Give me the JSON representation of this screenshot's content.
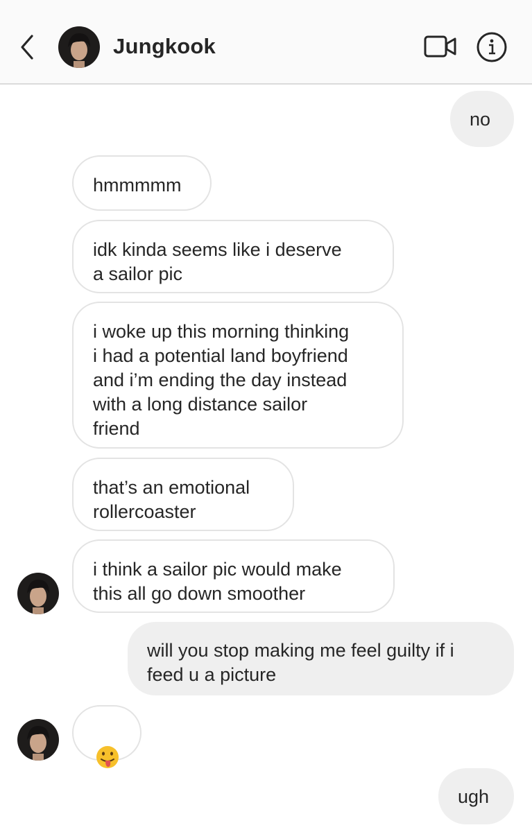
{
  "header": {
    "contact_name": "Jungkook",
    "back_icon": "chevron-left-icon",
    "video_icon": "video-camera-icon",
    "info_icon": "info-icon"
  },
  "messages": [
    {
      "from": "me",
      "text": "no"
    },
    {
      "from": "them",
      "text": "hmmmmm"
    },
    {
      "from": "them",
      "text": "idk kinda seems like i deserve\na sailor pic"
    },
    {
      "from": "them",
      "text": "i woke up this morning thinking\ni had a potential land boyfriend\nand i’m ending the day instead\nwith a long distance sailor\nfriend"
    },
    {
      "from": "them",
      "text": "that’s an emotional\nrollercoaster"
    },
    {
      "from": "them",
      "text": "i think a sailor pic would make\nthis all go down smoother"
    },
    {
      "from": "me",
      "text": "will you stop making me feel guilty if i\nfeed u a picture"
    },
    {
      "from": "them",
      "text": "",
      "emoji": "tongue-out-face-emoji"
    },
    {
      "from": "me",
      "text": "ugh"
    }
  ],
  "colors": {
    "header_bg": "#fafafa",
    "incoming_border": "#e3e3e3",
    "outgoing_bg": "#efefef",
    "text": "#262626"
  }
}
